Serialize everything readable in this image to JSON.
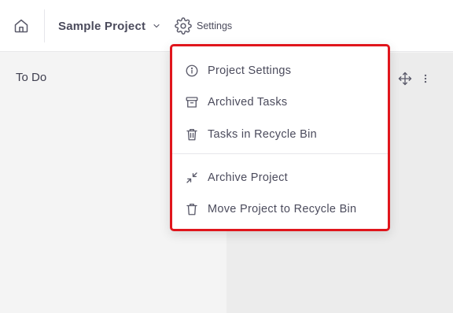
{
  "header": {
    "project_name": "Sample Project",
    "settings_label": "Settings",
    "icons": [
      "home-icon",
      "chevron-down-icon",
      "gear-icon"
    ]
  },
  "board": {
    "column_title": "To Do",
    "column_icons": [
      "move-icon",
      "more-vertical-icon"
    ]
  },
  "settings_menu": {
    "highlight_color": "#e0151c",
    "items": [
      {
        "label": "Project Settings",
        "icon": "info-icon"
      },
      {
        "label": "Archived Tasks",
        "icon": "archive-icon"
      },
      {
        "label": "Tasks in Recycle Bin",
        "icon": "trash-icon"
      },
      {
        "label": "Archive Project",
        "icon": "minimize-icon"
      },
      {
        "label": "Move Project to Recycle Bin",
        "icon": "trash-icon"
      }
    ]
  }
}
